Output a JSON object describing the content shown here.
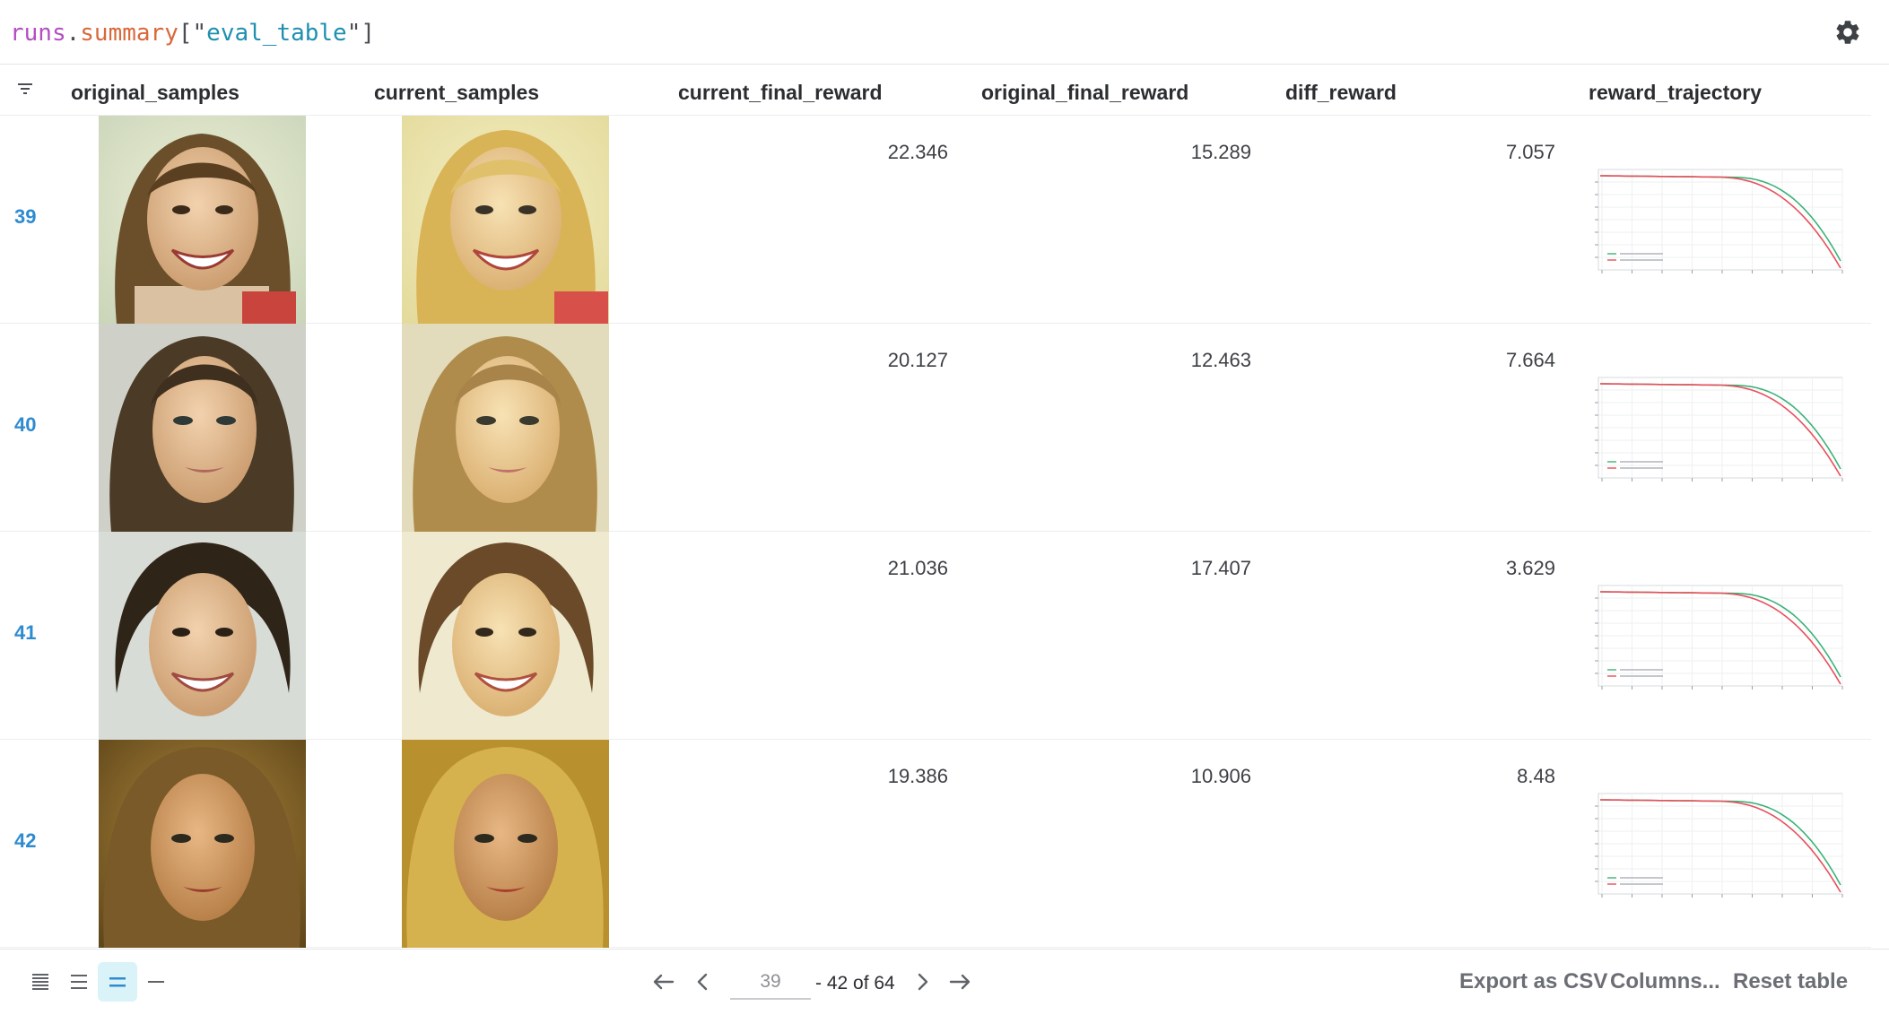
{
  "query": {
    "object": "runs",
    "dot": ".",
    "attribute": "summary",
    "open": "[\"",
    "key": "eval_table",
    "close": "\"]"
  },
  "settings_icon": "gear-icon",
  "table": {
    "columns": [
      "original_samples",
      "current_samples",
      "current_final_reward",
      "original_final_reward",
      "diff_reward",
      "reward_trajectory"
    ],
    "rows": [
      {
        "index": "39",
        "current_final_reward": "22.346",
        "original_final_reward": "15.289",
        "diff_reward": "7.057"
      },
      {
        "index": "40",
        "current_final_reward": "20.127",
        "original_final_reward": "12.463",
        "diff_reward": "7.664"
      },
      {
        "index": "41",
        "current_final_reward": "21.036",
        "original_final_reward": "17.407",
        "diff_reward": "3.629"
      },
      {
        "index": "42",
        "current_final_reward": "19.386",
        "original_final_reward": "10.906",
        "diff_reward": "8.48"
      }
    ]
  },
  "pagination": {
    "current_page_value": "39",
    "range_text": "- 42 of 64"
  },
  "footer": {
    "export_label": "Export as CSV",
    "columns_label": "Columns...",
    "reset_label": "Reset table"
  },
  "colors": {
    "accent": "#2e8bd0",
    "active_density_bg": "#d9f3f9",
    "current_trajectory": "#3bb37a",
    "initial_trajectory": "#e8505b"
  }
}
